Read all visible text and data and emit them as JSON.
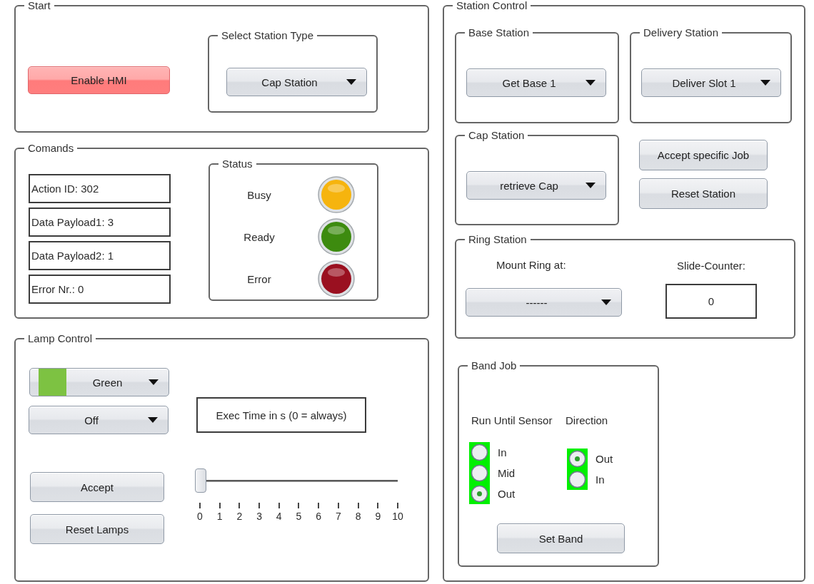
{
  "start": {
    "title": "Start",
    "enable_button": "Enable HMI",
    "station_type": {
      "title": "Select Station Type",
      "value": "Cap Station"
    }
  },
  "commands": {
    "title": "Comands",
    "readouts": [
      "Action ID: 302",
      "Data Payload1: 3",
      "Data Payload2: 1",
      "Error Nr.: 0"
    ],
    "status": {
      "title": "Status",
      "indicators": [
        {
          "label": "Busy",
          "color": "#f6b40e"
        },
        {
          "label": "Ready",
          "color": "#3d8b0f"
        },
        {
          "label": "Error",
          "color": "#9a1020"
        }
      ]
    }
  },
  "lamp_control": {
    "title": "Lamp Control",
    "color_select": {
      "value": "Green",
      "color": "#7dc242"
    },
    "mode_select": {
      "value": "Off"
    },
    "exec_time_label": "Exec Time in s (0 = always)",
    "slider": {
      "level": 0,
      "ticks": [
        "0",
        "1",
        "2",
        "3",
        "4",
        "5",
        "6",
        "7",
        "8",
        "9",
        "10"
      ]
    },
    "buttons": [
      "Accept",
      "Reset Lamps"
    ]
  },
  "station_control": {
    "title": "Station Control",
    "stations": [
      {
        "title": "Base Station",
        "value": "Get Base 1"
      },
      {
        "title": "Delivery Station",
        "value": "Deliver Slot 1"
      },
      {
        "title": "Cap Station",
        "value": "retrieve Cap"
      }
    ],
    "buttons": [
      "Accept specific Job",
      "Reset Station"
    ],
    "ring_station": {
      "title": "Ring Station",
      "mount_label": "Mount Ring at:",
      "mount_value": "------",
      "counter_label": "Slide-Counter:",
      "counter_value": "0"
    },
    "band_job": {
      "title": "Band Job",
      "groups": [
        {
          "title": "Run Until Sensor",
          "options": [
            {
              "label": "In",
              "selected": false
            },
            {
              "label": "Mid",
              "selected": false
            },
            {
              "label": "Out",
              "selected": true
            }
          ]
        },
        {
          "title": "Direction",
          "options": [
            {
              "label": "Out",
              "selected": true
            },
            {
              "label": "In",
              "selected": false
            }
          ]
        }
      ],
      "button": "Set Band"
    }
  }
}
